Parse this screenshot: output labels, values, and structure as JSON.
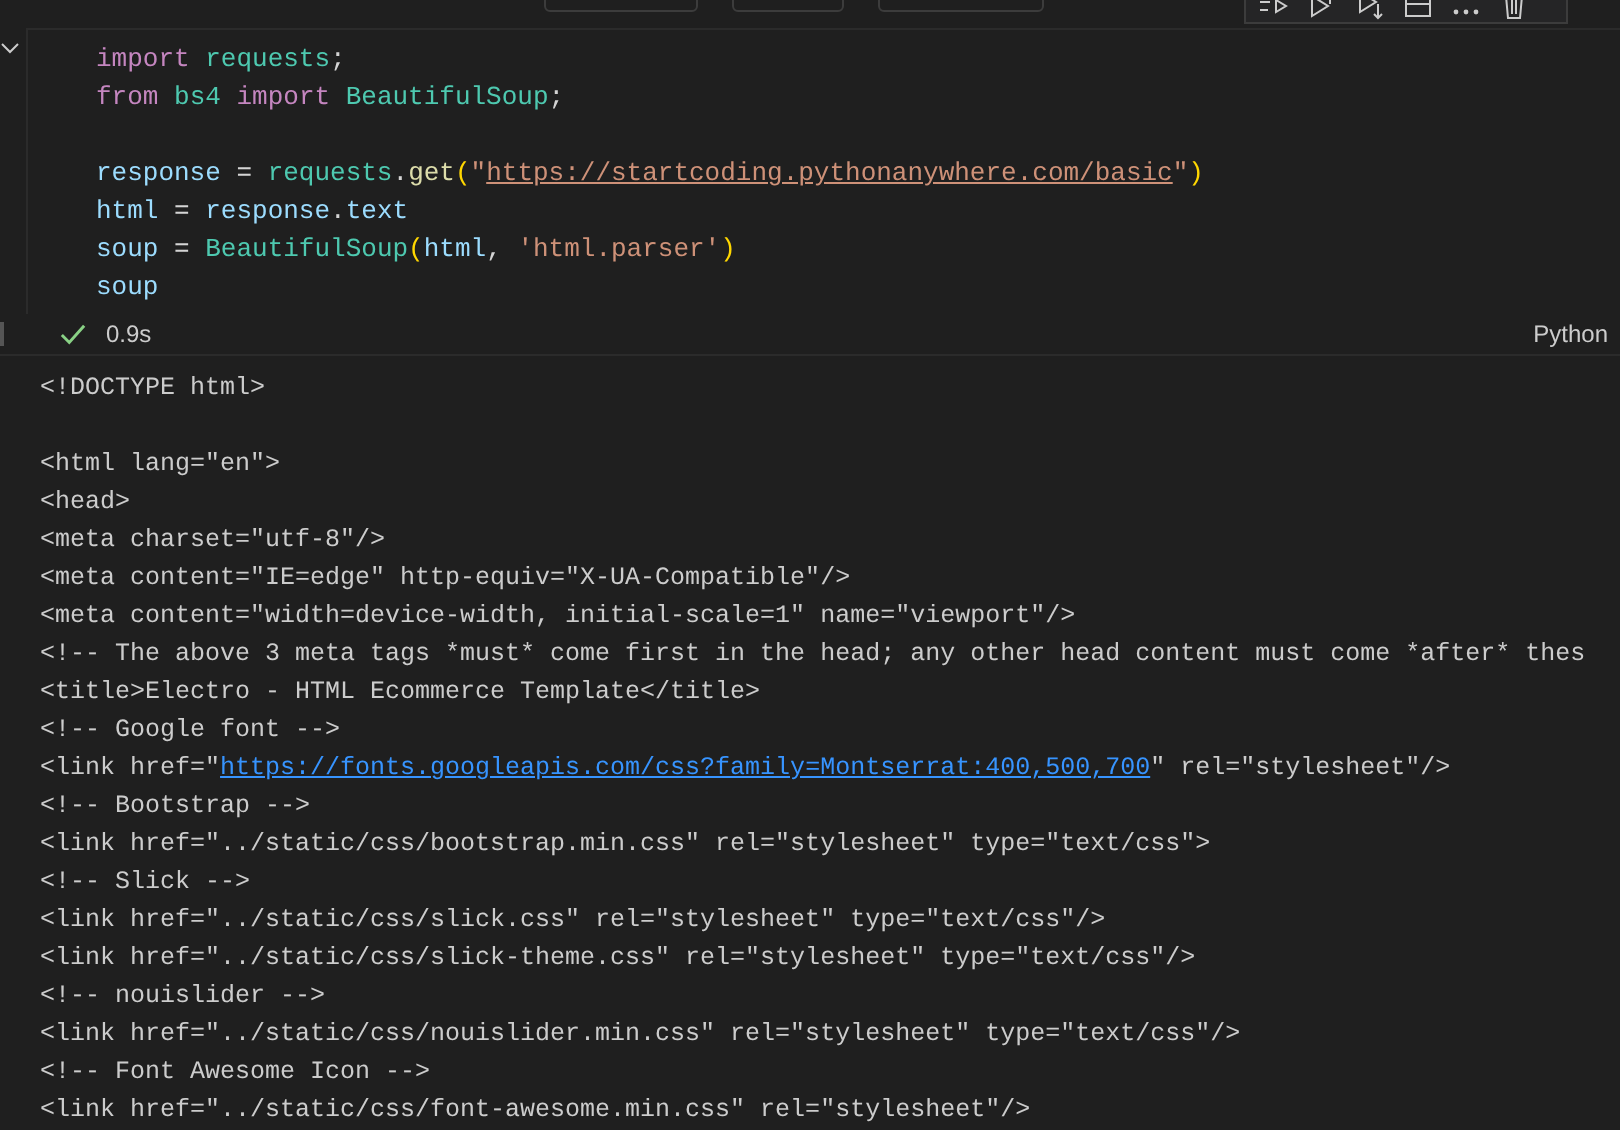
{
  "cell_toolbar": {
    "buttons": [
      {
        "kind": "generate"
      },
      {
        "kind": "code"
      },
      {
        "kind": "markdown"
      }
    ]
  },
  "cell_actions": [
    {
      "kind": "run-by-line"
    },
    {
      "kind": "run-above"
    },
    {
      "kind": "run-below"
    },
    {
      "kind": "split"
    },
    {
      "kind": "more"
    },
    {
      "kind": "delete"
    }
  ],
  "code_lines": [
    {
      "tokens": [
        {
          "kind": "keyword",
          "text": "import"
        },
        {
          "kind": "module",
          "text": " requests"
        },
        {
          "kind": "plain",
          "text": ";"
        }
      ]
    },
    {
      "tokens": [
        {
          "kind": "keyword",
          "text": "from"
        },
        {
          "kind": "module",
          "text": " bs4"
        },
        {
          "kind": "keyword",
          "text": " import"
        },
        {
          "kind": "module",
          "text": " BeautifulSoup"
        },
        {
          "kind": "plain",
          "text": ";"
        }
      ]
    },
    {
      "blank": true
    },
    {
      "tokens": [
        {
          "kind": "variable",
          "text": "response"
        },
        {
          "kind": "plain",
          "text": " = "
        },
        {
          "kind": "module",
          "text": "requests"
        },
        {
          "kind": "plain",
          "text": "."
        },
        {
          "kind": "function",
          "text": "get"
        },
        {
          "kind": "paren",
          "text": "("
        },
        {
          "kind": "string",
          "text": "\""
        },
        {
          "kind": "url",
          "text": "https://startcoding.pythonanywhere.com/basic"
        },
        {
          "kind": "string",
          "text": "\""
        },
        {
          "kind": "paren",
          "text": ")"
        }
      ]
    },
    {
      "tokens": [
        {
          "kind": "variable",
          "text": "html"
        },
        {
          "kind": "plain",
          "text": " = "
        },
        {
          "kind": "variable",
          "text": "response"
        },
        {
          "kind": "plain",
          "text": "."
        },
        {
          "kind": "variable",
          "text": "text"
        }
      ]
    },
    {
      "tokens": [
        {
          "kind": "variable",
          "text": "soup"
        },
        {
          "kind": "plain",
          "text": " = "
        },
        {
          "kind": "module",
          "text": "BeautifulSoup"
        },
        {
          "kind": "paren",
          "text": "("
        },
        {
          "kind": "variable",
          "text": "html"
        },
        {
          "kind": "plain",
          "text": ", "
        },
        {
          "kind": "string",
          "text": "'html.parser'"
        },
        {
          "kind": "paren",
          "text": ")"
        }
      ]
    },
    {
      "tokens": [
        {
          "kind": "variable",
          "text": "soup"
        }
      ]
    }
  ],
  "status": {
    "succeeded": true,
    "duration": "0.9s",
    "language": "Python"
  },
  "output_lines": [
    {
      "segments": [
        {
          "kind": "text",
          "text": "<!DOCTYPE html>"
        }
      ]
    },
    {
      "blank": true
    },
    {
      "segments": [
        {
          "kind": "text",
          "text": "<html lang=\"en\">"
        }
      ]
    },
    {
      "segments": [
        {
          "kind": "text",
          "text": "<head>"
        }
      ]
    },
    {
      "segments": [
        {
          "kind": "text",
          "text": "<meta charset=\"utf-8\"/>"
        }
      ]
    },
    {
      "segments": [
        {
          "kind": "text",
          "text": "<meta content=\"IE=edge\" http-equiv=\"X-UA-Compatible\"/>"
        }
      ]
    },
    {
      "segments": [
        {
          "kind": "text",
          "text": "<meta content=\"width=device-width, initial-scale=1\" name=\"viewport\"/>"
        }
      ]
    },
    {
      "segments": [
        {
          "kind": "text",
          "text": "<!-- The above 3 meta tags *must* come first in the head; any other head content must come *after* thes"
        }
      ]
    },
    {
      "segments": [
        {
          "kind": "text",
          "text": "<title>Electro - HTML Ecommerce Template</title>"
        }
      ]
    },
    {
      "segments": [
        {
          "kind": "text",
          "text": "<!-- Google font -->"
        }
      ]
    },
    {
      "segments": [
        {
          "kind": "text",
          "text": "<link href=\""
        },
        {
          "kind": "link",
          "text": "https://fonts.googleapis.com/css?family=Montserrat:400,500,700"
        },
        {
          "kind": "text",
          "text": "\" rel=\"stylesheet\"/>"
        }
      ]
    },
    {
      "segments": [
        {
          "kind": "text",
          "text": "<!-- Bootstrap -->"
        }
      ]
    },
    {
      "segments": [
        {
          "kind": "text",
          "text": "<link href=\"../static/css/bootstrap.min.css\" rel=\"stylesheet\" type=\"text/css\">"
        }
      ]
    },
    {
      "segments": [
        {
          "kind": "text",
          "text": "<!-- Slick -->"
        }
      ]
    },
    {
      "segments": [
        {
          "kind": "text",
          "text": "<link href=\"../static/css/slick.css\" rel=\"stylesheet\" type=\"text/css\"/>"
        }
      ]
    },
    {
      "segments": [
        {
          "kind": "text",
          "text": "<link href=\"../static/css/slick-theme.css\" rel=\"stylesheet\" type=\"text/css\"/>"
        }
      ]
    },
    {
      "segments": [
        {
          "kind": "text",
          "text": "<!-- nouislider -->"
        }
      ]
    },
    {
      "segments": [
        {
          "kind": "text",
          "text": "<link href=\"../static/css/nouislider.min.css\" rel=\"stylesheet\" type=\"text/css\"/>"
        }
      ]
    },
    {
      "segments": [
        {
          "kind": "text",
          "text": "<!-- Font Awesome Icon -->"
        }
      ]
    },
    {
      "segments": [
        {
          "kind": "text",
          "text": "<link href=\"../static/css/font-awesome.min.css\" rel=\"stylesheet\"/>"
        }
      ]
    }
  ]
}
